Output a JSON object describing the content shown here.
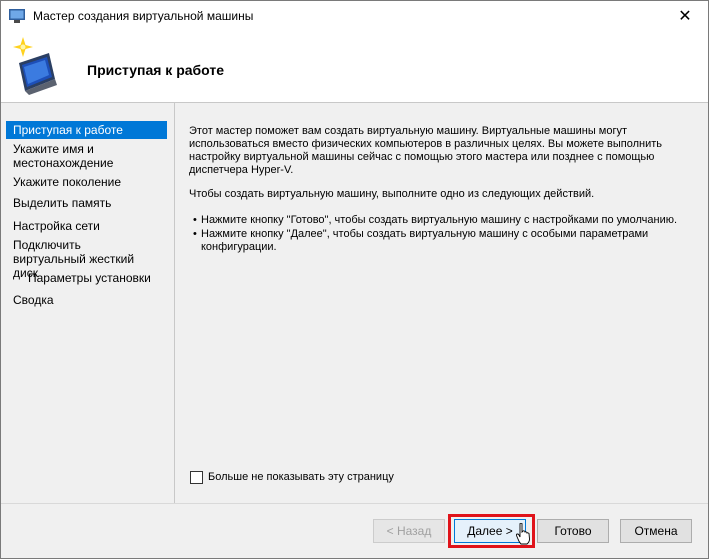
{
  "window": {
    "title": "Мастер создания виртуальной машины",
    "close_glyph": "✕"
  },
  "header": {
    "heading": "Приступая к работе"
  },
  "nav": {
    "items": [
      {
        "label": "Приступая к работе"
      },
      {
        "label": "Укажите имя и местонахождение"
      },
      {
        "label": "Укажите поколение"
      },
      {
        "label": "Выделить память"
      },
      {
        "label": "Настройка сети"
      },
      {
        "label": "Подключить виртуальный жесткий диск"
      },
      {
        "label": "Параметры установки"
      },
      {
        "label": "Сводка"
      }
    ],
    "active_index": 0
  },
  "content": {
    "intro": "Этот мастер поможет вам создать виртуальную машину. Виртуальные машины могут использоваться вместо физических компьютеров в различных целях. Вы можете выполнить настройку виртуальной машины сейчас с помощью этого мастера или позднее с помощью диспетчера Hyper-V.",
    "instruction": "Чтобы создать виртуальную машину, выполните одно из следующих действий.",
    "bullets": [
      "Нажмите кнопку \"Готово\", чтобы создать виртуальную машину с настройками по умолчанию.",
      "Нажмите кнопку \"Далее\", чтобы создать виртуальную машину с особыми параметрами конфигурации."
    ],
    "bullet_glyph": "•",
    "checkbox_label": "Больше не показывать эту страницу"
  },
  "buttons": {
    "back": "< Назад",
    "next": "Далее >",
    "finish": "Готово",
    "cancel": "Отмена"
  },
  "colors": {
    "selection": "#0078d7",
    "highlight": "#e0131a"
  }
}
